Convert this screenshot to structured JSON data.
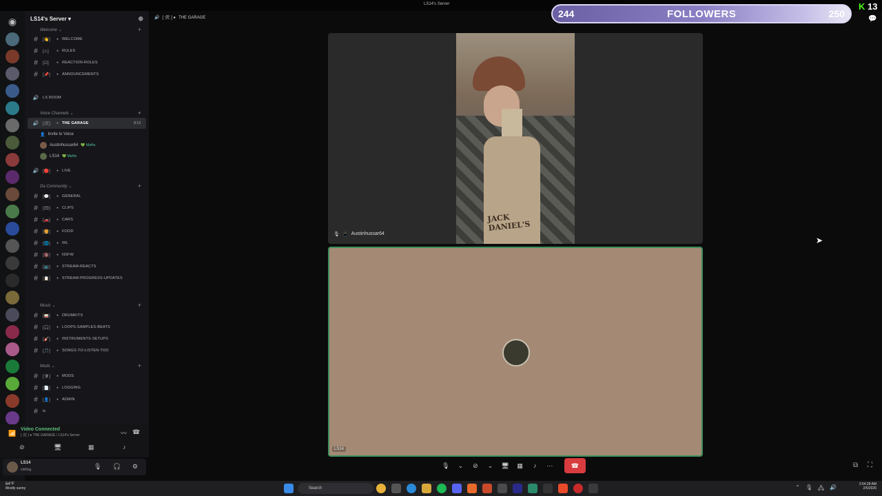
{
  "window": {
    "title": "LS14's Server"
  },
  "server": {
    "name": "LS14's Server ▾"
  },
  "channel_header": {
    "name": "THE GARAGE",
    "prefix": "[ 🛠 ] ●"
  },
  "categories": {
    "welcome": "Welcome ⌄",
    "voice": "Voice Channels ⌄",
    "community": "Da Community ⌄",
    "music": "Music ⌄",
    "mods": "Mods ⌄"
  },
  "channels": {
    "welcome": "WELCOME",
    "rules": "RULES",
    "reaction_roles": "REACTION-ROLES",
    "announcements": "ANNOUNCEMENTS",
    "ls_room": "LS ROOM",
    "the_garage": "THE GARAGE",
    "garage_timer": "8:19",
    "invite": "Invite to Voice",
    "live": "LIVE",
    "general": "GENERAL",
    "clips": "CLIPS",
    "cars": "CARS",
    "food": "FOOD",
    "irl": "IRL",
    "nsfw": "NSFW",
    "stream_reacts": "STREAM-REACTS",
    "stream_progress": "STREAM-PROGRESS-UPDATES",
    "drumkits": "DRUMKITS",
    "loops": "LOOPS-SAMPLES-BEATS",
    "instruments": "INSTRUMENTS-SETUPS",
    "songs": "SONGS-TO-LISTEN-TOO",
    "mods": "MODS",
    "logging": "LOGGING",
    "admin": "ADMIN",
    "ls": "ls"
  },
  "voice_users": [
    {
      "name": "Austinhussar64",
      "tag": "💚 MaHa"
    },
    {
      "name": "LS14",
      "tag": "💚 MaHa"
    }
  ],
  "connection": {
    "status": "Video Connected",
    "location": "[ 🛠 ] ● THE GARAGE / LS14's Server"
  },
  "user_panel": {
    "name": "LS14",
    "status": "chilling"
  },
  "followers": {
    "current": "244",
    "label": "FOLLOWERS",
    "goal": "250"
  },
  "kick": {
    "count": "13"
  },
  "tiles": {
    "user1": "Austinhussar64",
    "user2": "LS14",
    "bottle_label": "JACK DANIEL'S"
  },
  "taskbar": {
    "weather_temp": "64°F",
    "weather_desc": "Mostly sunny",
    "search_placeholder": "Search",
    "time": "3:54:28 AM",
    "date": "2/5/2026"
  },
  "colors": {
    "accent_green": "#3d8f5c",
    "hangup_red": "#d83c3e",
    "kick_green": "#53fc18"
  }
}
